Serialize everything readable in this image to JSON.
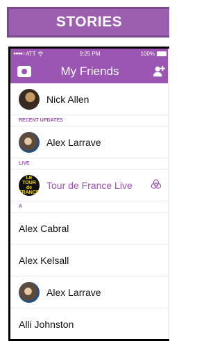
{
  "banner": {
    "label": "STORIES"
  },
  "status_bar": {
    "carrier": "ATT",
    "time": "9:25 PM",
    "battery": "100%"
  },
  "nav": {
    "title": "My Friends"
  },
  "top_friend": {
    "name": "Nick Allen"
  },
  "sections": {
    "recent_updates": "RECENT UPDATES",
    "live": "LIVE",
    "a": "A"
  },
  "recent": {
    "name": "Alex Larrave"
  },
  "live_story": {
    "name": "Tour de France Live",
    "logo_text": "Le Tour de France"
  },
  "friends_a": [
    {
      "name": "Alex Cabral"
    },
    {
      "name": "Alex Kelsall"
    },
    {
      "name": "Alex Larrave"
    },
    {
      "name": "Alli Johnston"
    }
  ],
  "colors": {
    "accent": "#9b55b3",
    "banner": "#9c5fb0"
  }
}
